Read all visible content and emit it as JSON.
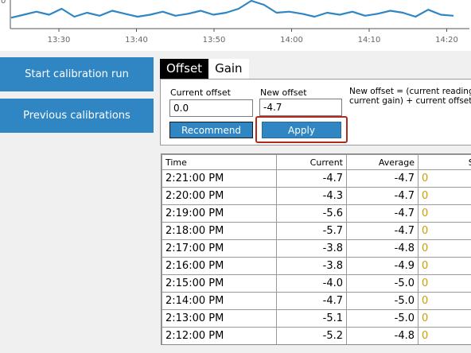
{
  "chart_data": {
    "type": "line",
    "x_ticks": [
      "13:30",
      "13:40",
      "13:50",
      "14:00",
      "14:10",
      "14:20"
    ],
    "y_ticks": [
      "0"
    ],
    "series": [
      {
        "values": [
          -4.9,
          -4.6,
          -4.3,
          -4.6,
          -4.0,
          -4.8,
          -4.4,
          -4.7,
          -4.2,
          -4.5,
          -4.8,
          -4.6,
          -4.3,
          -4.7,
          -4.5,
          -4.2,
          -4.6,
          -4.4,
          -4.0,
          -3.2,
          -3.6,
          -4.4,
          -4.3,
          -4.5,
          -4.8,
          -4.4,
          -4.6,
          -4.3,
          -4.7,
          -4.5,
          -4.2,
          -4.4,
          -4.8,
          -4.1,
          -4.6,
          -4.7
        ]
      }
    ],
    "grid": false
  },
  "sidebar": {
    "start_label": "Start calibration run",
    "previous_label": "Previous calibrations"
  },
  "tabs": [
    {
      "label": "Offset",
      "active": true
    },
    {
      "label": "Gain",
      "active": false
    }
  ],
  "offset_panel": {
    "current_offset_label": "Current offset",
    "current_offset_value": "0.0",
    "new_offset_label": "New offset",
    "new_offset_value": "-4.7",
    "formula_line1": "New offset = (current reading /",
    "formula_line2": "current gain) + current offset",
    "recommend_label": "Recommend",
    "apply_label": "Apply"
  },
  "table": {
    "headers": [
      "Time",
      "Current",
      "Average",
      "Std D"
    ],
    "rows": [
      [
        "2:21:00 PM",
        "-4.7",
        "-4.7",
        "0"
      ],
      [
        "2:20:00 PM",
        "-4.3",
        "-4.7",
        "0"
      ],
      [
        "2:19:00 PM",
        "-5.6",
        "-4.7",
        "0"
      ],
      [
        "2:18:00 PM",
        "-5.7",
        "-4.7",
        "0"
      ],
      [
        "2:17:00 PM",
        "-3.8",
        "-4.8",
        "0"
      ],
      [
        "2:16:00 PM",
        "-3.8",
        "-4.9",
        "0"
      ],
      [
        "2:15:00 PM",
        "-4.0",
        "-5.0",
        "0"
      ],
      [
        "2:14:00 PM",
        "-4.7",
        "-5.0",
        "0"
      ],
      [
        "2:13:00 PM",
        "-5.1",
        "-5.0",
        "0"
      ],
      [
        "2:12:00 PM",
        "-5.2",
        "-4.8",
        "0"
      ]
    ]
  },
  "colors": {
    "accent": "#2f86c3",
    "line": "#2f86c3",
    "highlight": "#b22a1f"
  }
}
